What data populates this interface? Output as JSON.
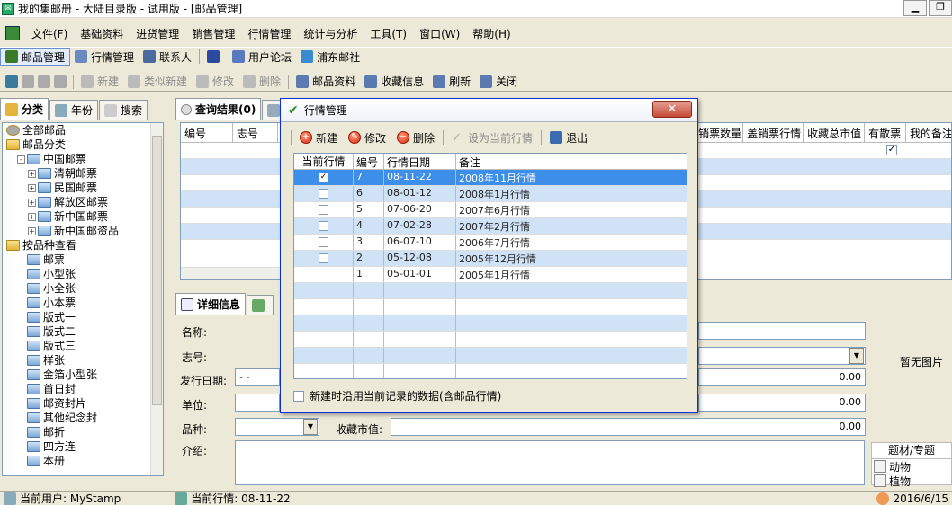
{
  "window": {
    "title": "我的集邮册 - 大陆目录版 - 试用版 - [邮品管理]"
  },
  "menu": [
    "文件(F)",
    "基础资料",
    "进货管理",
    "销售管理",
    "行情管理",
    "统计与分析",
    "工具(T)",
    "窗口(W)",
    "帮助(H)"
  ],
  "toolbar1": [
    {
      "label": "邮品管理",
      "icon": "stamp-icon",
      "color": "#3a7a2a"
    },
    {
      "label": "行情管理",
      "icon": "document-icon",
      "color": "#6a8ac0"
    },
    {
      "label": "联系人",
      "icon": "contact-icon",
      "color": "#4a6aa0"
    },
    {
      "label": "",
      "icon": "help-icon",
      "color": "#2a4aa0"
    },
    {
      "label": "用户论坛",
      "icon": "forum-icon",
      "color": "#5a7ac0"
    },
    {
      "label": "浦东邮社",
      "icon": "globe-icon",
      "color": "#3a8ad0"
    }
  ],
  "toolbar2": [
    {
      "label": "新建",
      "icon": "new-icon",
      "enabled": false
    },
    {
      "label": "类似新建",
      "icon": "copy-new-icon",
      "enabled": false
    },
    {
      "label": "修改",
      "icon": "edit-icon",
      "enabled": false
    },
    {
      "label": "删除",
      "icon": "delete-icon",
      "enabled": false
    },
    {
      "label": "邮品资料",
      "icon": "printer-icon",
      "enabled": true
    },
    {
      "label": "收藏信息",
      "icon": "printer2-icon",
      "enabled": true
    },
    {
      "label": "刷新",
      "icon": "refresh-icon",
      "enabled": true
    },
    {
      "label": "关闭",
      "icon": "close-door-icon",
      "enabled": true
    }
  ],
  "left_tabs": [
    "分类",
    "年份",
    "搜索"
  ],
  "tree": [
    {
      "label": "全部邮品",
      "indent": 0,
      "exp": "",
      "folder": "root"
    },
    {
      "label": "邮品分类",
      "indent": 0,
      "exp": "",
      "folder": "yellow"
    },
    {
      "label": "中国邮票",
      "indent": 1,
      "exp": "-",
      "folder": "blue"
    },
    {
      "label": "清朝邮票",
      "indent": 2,
      "exp": "+",
      "folder": "blue"
    },
    {
      "label": "民国邮票",
      "indent": 2,
      "exp": "+",
      "folder": "blue"
    },
    {
      "label": "解放区邮票",
      "indent": 2,
      "exp": "+",
      "folder": "blue"
    },
    {
      "label": "新中国邮票",
      "indent": 2,
      "exp": "+",
      "folder": "blue"
    },
    {
      "label": "新中国邮资品",
      "indent": 2,
      "exp": "+",
      "folder": "blue"
    },
    {
      "label": "按品种查看",
      "indent": 0,
      "exp": "",
      "folder": "yellow"
    },
    {
      "label": "邮票",
      "indent": 1,
      "exp": "",
      "folder": "blue"
    },
    {
      "label": "小型张",
      "indent": 1,
      "exp": "",
      "folder": "blue"
    },
    {
      "label": "小全张",
      "indent": 1,
      "exp": "",
      "folder": "blue"
    },
    {
      "label": "小本票",
      "indent": 1,
      "exp": "",
      "folder": "blue"
    },
    {
      "label": "版式一",
      "indent": 1,
      "exp": "",
      "folder": "blue"
    },
    {
      "label": "版式二",
      "indent": 1,
      "exp": "",
      "folder": "blue"
    },
    {
      "label": "版式三",
      "indent": 1,
      "exp": "",
      "folder": "blue"
    },
    {
      "label": "样张",
      "indent": 1,
      "exp": "",
      "folder": "blue"
    },
    {
      "label": "金箔小型张",
      "indent": 1,
      "exp": "",
      "folder": "blue"
    },
    {
      "label": "首日封",
      "indent": 1,
      "exp": "",
      "folder": "blue"
    },
    {
      "label": "邮资封片",
      "indent": 1,
      "exp": "",
      "folder": "blue"
    },
    {
      "label": "其他纪念封",
      "indent": 1,
      "exp": "",
      "folder": "blue"
    },
    {
      "label": "邮折",
      "indent": 1,
      "exp": "",
      "folder": "blue"
    },
    {
      "label": "四方连",
      "indent": 1,
      "exp": "",
      "folder": "blue"
    },
    {
      "label": "本册",
      "indent": 1,
      "exp": "",
      "folder": "blue"
    }
  ],
  "main_tab": "查询结果(0)",
  "grid": {
    "headers_left": [
      "编号",
      "志号"
    ],
    "headers_right": [
      "销票数量",
      "盖销票行情",
      "收藏总市值",
      "有散票",
      "我的备注"
    ]
  },
  "detail": {
    "tab": "详细信息",
    "labels": {
      "name": "名称:",
      "code": "志号:",
      "issue_date": "发行日期:",
      "unit": "单位:",
      "variety": "品种:",
      "intro": "介绍:",
      "market_value": "收藏市值:"
    },
    "issue_date_value": "- -",
    "values": [
      "0.00",
      "0.00",
      "0.00"
    ],
    "no_picture": "暂无图片",
    "topic_header": "题材/专题",
    "topics": [
      "动物",
      "植物"
    ]
  },
  "status": {
    "user": "当前用户: MyStamp",
    "market": "当前行情: 08-11-22",
    "date": "2016/6/15"
  },
  "dialog": {
    "title": "行情管理",
    "close": "✕",
    "buttons": [
      {
        "label": "新建",
        "icon": "add-icon",
        "enabled": true
      },
      {
        "label": "修改",
        "icon": "edit-icon",
        "enabled": true
      },
      {
        "label": "删除",
        "icon": "remove-icon",
        "enabled": true
      },
      {
        "label": "设为当前行情",
        "icon": "checkmark-icon",
        "enabled": false
      },
      {
        "label": "退出",
        "icon": "exit-icon",
        "enabled": true
      }
    ],
    "headers": [
      "当前行情",
      "编号",
      "行情日期",
      "备注"
    ],
    "rows": [
      {
        "current": true,
        "id": "7",
        "date": "08-11-22",
        "note": "2008年11月行情"
      },
      {
        "current": false,
        "id": "6",
        "date": "08-01-12",
        "note": "2008年1月行情"
      },
      {
        "current": false,
        "id": "5",
        "date": "07-06-20",
        "note": "2007年6月行情"
      },
      {
        "current": false,
        "id": "4",
        "date": "07-02-28",
        "note": "2007年2月行情"
      },
      {
        "current": false,
        "id": "3",
        "date": "06-07-10",
        "note": "2006年7月行情"
      },
      {
        "current": false,
        "id": "2",
        "date": "05-12-08",
        "note": "2005年12月行情"
      },
      {
        "current": false,
        "id": "1",
        "date": "05-01-01",
        "note": "2005年1月行情"
      }
    ],
    "footer_checkbox": "新建时沿用当前记录的数据(含邮品行情)"
  }
}
